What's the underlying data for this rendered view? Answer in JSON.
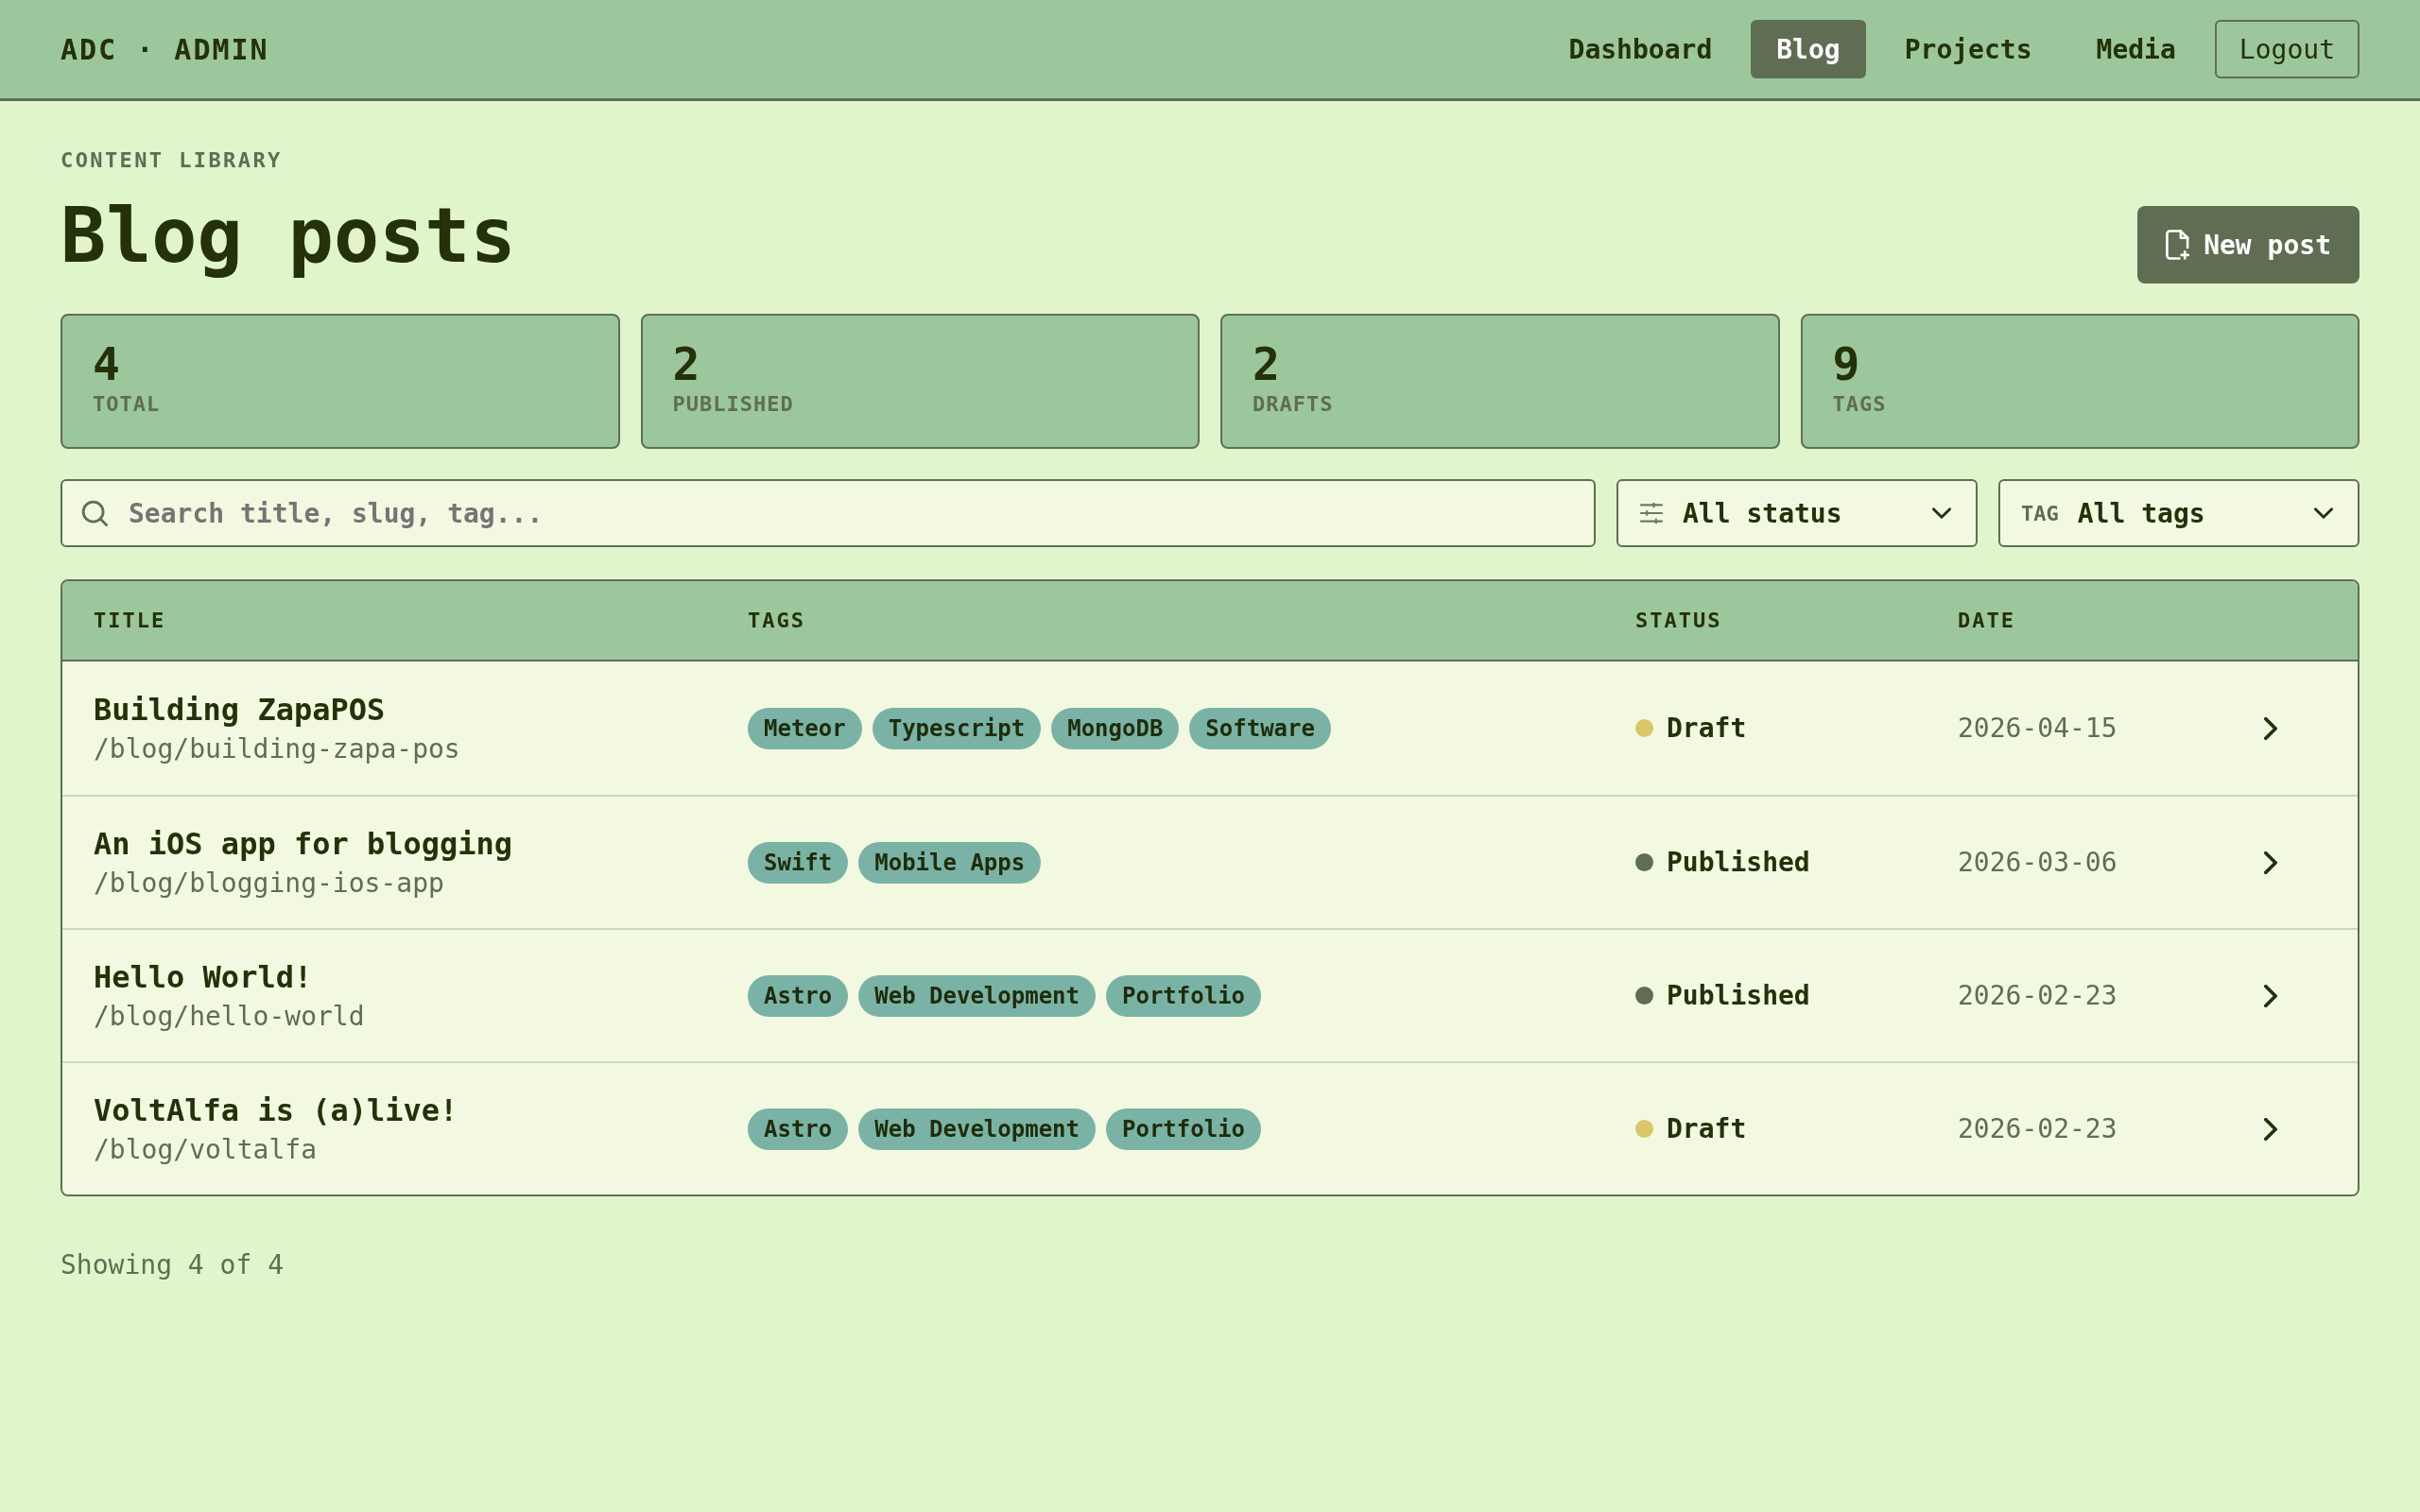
{
  "brand": "ADC · ADMIN",
  "nav": {
    "items": [
      {
        "label": "Dashboard",
        "selected": false
      },
      {
        "label": "Blog",
        "selected": true
      },
      {
        "label": "Projects",
        "selected": false
      },
      {
        "label": "Media",
        "selected": false
      }
    ],
    "logout": "Logout"
  },
  "page": {
    "eyebrow": "CONTENT LIBRARY",
    "title": "Blog posts",
    "new_post_button": "New post"
  },
  "stats": [
    {
      "value": "4",
      "label": "TOTAL"
    },
    {
      "value": "2",
      "label": "PUBLISHED"
    },
    {
      "value": "2",
      "label": "DRAFTS"
    },
    {
      "value": "9",
      "label": "TAGS"
    }
  ],
  "filters": {
    "search": {
      "placeholder": "Search title, slug, tag..."
    },
    "status_select": {
      "value": "All status"
    },
    "tag_select": {
      "label": "TAG",
      "value": "All tags"
    }
  },
  "table": {
    "columns": [
      "TITLE",
      "TAGS",
      "STATUS",
      "DATE"
    ],
    "rows": [
      {
        "title": "Building ZapaPOS",
        "slug": "/blog/building-zapa-pos",
        "tags": [
          "Meteor",
          "Typescript",
          "MongoDB",
          "Software"
        ],
        "status": {
          "label": "Draft",
          "color": "#dcc66b"
        },
        "date": "2026-04-15"
      },
      {
        "title": "An iOS app for blogging",
        "slug": "/blog/blogging-ios-app",
        "tags": [
          "Swift",
          "Mobile Apps"
        ],
        "status": {
          "label": "Published",
          "color": "#5f6e52"
        },
        "date": "2026-03-06"
      },
      {
        "title": "Hello World!",
        "slug": "/blog/hello-world",
        "tags": [
          "Astro",
          "Web Development",
          "Portfolio"
        ],
        "status": {
          "label": "Published",
          "color": "#5f6e52"
        },
        "date": "2026-02-23"
      },
      {
        "title": "VoltAlfa is (a)live!",
        "slug": "/blog/voltalfa",
        "tags": [
          "Astro",
          "Web Development",
          "Portfolio"
        ],
        "status": {
          "label": "Draft",
          "color": "#dcc66b"
        },
        "date": "2026-02-23"
      }
    ]
  },
  "footer": {
    "summary": "Showing 4 of 4"
  }
}
